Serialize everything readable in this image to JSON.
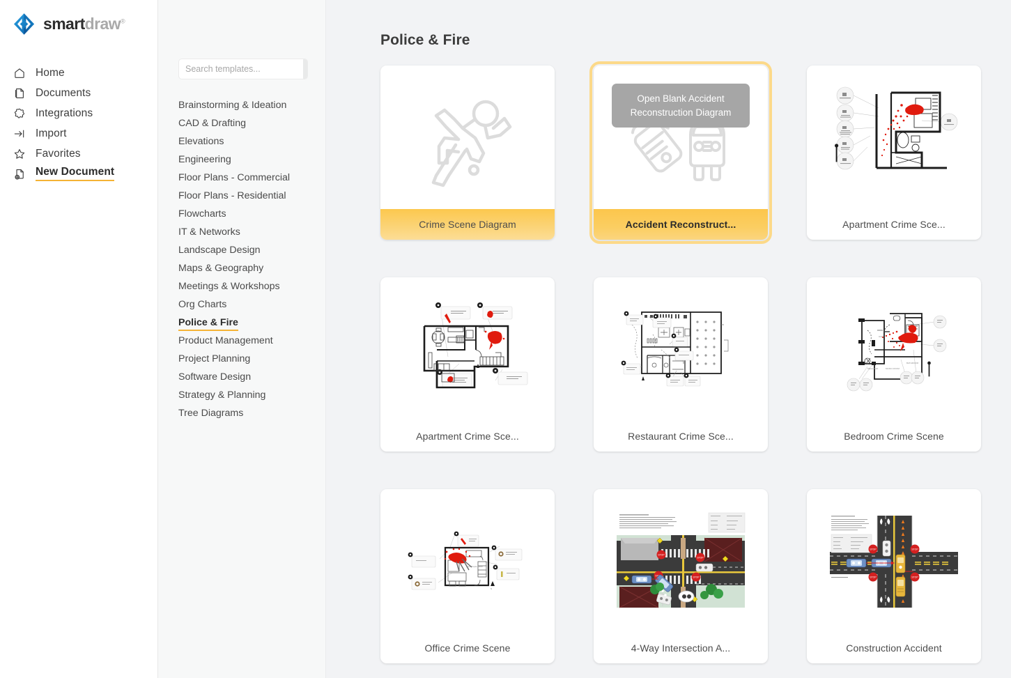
{
  "brand": {
    "name_first": "smart",
    "name_second": "draw",
    "trademark": "®",
    "logo_icon": "smartdraw-diamond-logo",
    "logo_color": "#0b72c4"
  },
  "nav": {
    "items": [
      {
        "label": "Home",
        "icon": "home-icon",
        "active": false
      },
      {
        "label": "Documents",
        "icon": "document-icon",
        "active": false
      },
      {
        "label": "Integrations",
        "icon": "puzzle-piece-icon",
        "active": false
      },
      {
        "label": "Import",
        "icon": "import-arrow-icon",
        "active": false
      },
      {
        "label": "Favorites",
        "icon": "star-icon",
        "active": false
      },
      {
        "label": "New Document",
        "icon": "new-document-icon",
        "active": true
      }
    ]
  },
  "search": {
    "placeholder": "Search templates...",
    "value": "",
    "button_icon": "search-icon"
  },
  "categories": {
    "items": [
      {
        "label": "Brainstorming & Ideation",
        "active": false
      },
      {
        "label": "CAD & Drafting",
        "active": false
      },
      {
        "label": "Elevations",
        "active": false
      },
      {
        "label": "Engineering",
        "active": false
      },
      {
        "label": "Floor Plans - Commercial",
        "active": false
      },
      {
        "label": "Floor Plans - Residential",
        "active": false
      },
      {
        "label": "Flowcharts",
        "active": false
      },
      {
        "label": "IT & Networks",
        "active": false
      },
      {
        "label": "Landscape Design",
        "active": false
      },
      {
        "label": "Maps & Geography",
        "active": false
      },
      {
        "label": "Meetings & Workshops",
        "active": false
      },
      {
        "label": "Org Charts",
        "active": false
      },
      {
        "label": "Police & Fire",
        "active": true
      },
      {
        "label": "Product Management",
        "active": false
      },
      {
        "label": "Project Planning",
        "active": false
      },
      {
        "label": "Software Design",
        "active": false
      },
      {
        "label": "Strategy & Planning",
        "active": false
      },
      {
        "label": "Tree Diagrams",
        "active": false
      }
    ]
  },
  "main": {
    "title": "Police & Fire",
    "hover_tooltip": "Open Blank Accident Reconstruction Diagram",
    "templates": [
      {
        "label": "Crime Scene Diagram",
        "thumb": "body-outline-ghost-icon",
        "style": "accent",
        "highlighted": false
      },
      {
        "label": "Accident Reconstruct...",
        "thumb": "car-collision-ghost-icon",
        "style": "accent-bold",
        "highlighted": true
      },
      {
        "label": "Apartment Crime Sce...",
        "thumb": "apartment-floorplan-vertical",
        "style": "plain",
        "highlighted": false
      },
      {
        "label": "Apartment Crime Sce...",
        "thumb": "apartment-floorplan-wide",
        "style": "plain",
        "highlighted": false
      },
      {
        "label": "Restaurant Crime Sce...",
        "thumb": "restaurant-floorplan",
        "style": "plain",
        "highlighted": false
      },
      {
        "label": "Bedroom Crime Scene",
        "thumb": "bedroom-floorplan",
        "style": "plain",
        "highlighted": false
      },
      {
        "label": "Office Crime Scene",
        "thumb": "office-floorplan",
        "style": "plain",
        "highlighted": false
      },
      {
        "label": "4-Way Intersection A...",
        "thumb": "intersection-accident-map",
        "style": "plain",
        "highlighted": false
      },
      {
        "label": "Construction Accident",
        "thumb": "construction-accident-map",
        "style": "plain",
        "highlighted": false
      }
    ]
  },
  "colors": {
    "accent": "#f5b335",
    "label_bar": "#fbc94f",
    "highlight_ring": "#fcd989",
    "tooltip_bg": "#a6a6a6",
    "blood_red": "#e01b0e",
    "road_dark": "#3b3b3b"
  }
}
